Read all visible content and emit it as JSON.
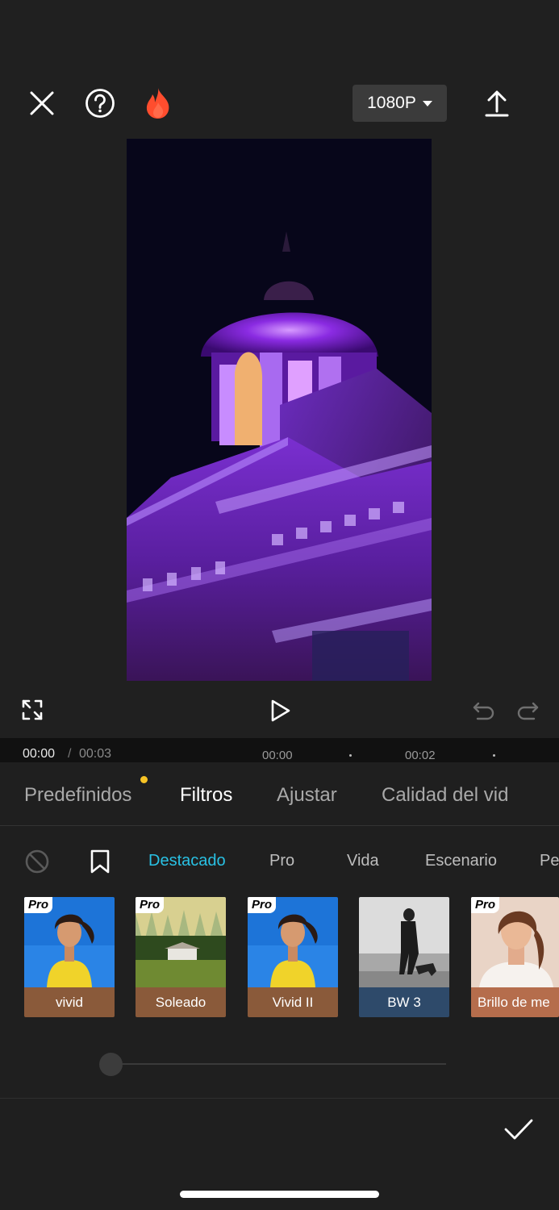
{
  "toolbar": {
    "resolution": "1080P",
    "icons": [
      "close-icon",
      "help-icon",
      "fire-icon",
      "export-icon"
    ]
  },
  "player": {
    "current_time": "00:00",
    "separator": "/",
    "duration": "00:03",
    "ticks": [
      "00:00",
      "00:02"
    ]
  },
  "tabs": [
    {
      "label": "Predefinidos"
    },
    {
      "label": "Filtros"
    },
    {
      "label": "Ajustar"
    },
    {
      "label": "Calidad del vid"
    }
  ],
  "categories": [
    {
      "label": "Destacado"
    },
    {
      "label": "Pro"
    },
    {
      "label": "Vida"
    },
    {
      "label": "Escenario"
    },
    {
      "label": "Pe"
    }
  ],
  "filters": [
    {
      "label": "vivid",
      "badge": "Pro",
      "label_color": "#8a5a3a"
    },
    {
      "label": "Soleado",
      "badge": "Pro",
      "label_color": "#8a5a3a"
    },
    {
      "label": "Vivid II",
      "badge": "Pro",
      "label_color": "#8a5a3a"
    },
    {
      "label": "BW 3",
      "badge": "",
      "label_color": "#2e4a6a"
    },
    {
      "label": "Brillo de me",
      "badge": "Pro",
      "label_color": "#b56d4c"
    }
  ],
  "colors": {
    "accent": "#29c1e4",
    "notification_dot": "#f7c325",
    "fire": "#ff4d2e"
  },
  "intensity": {
    "value": 0
  }
}
